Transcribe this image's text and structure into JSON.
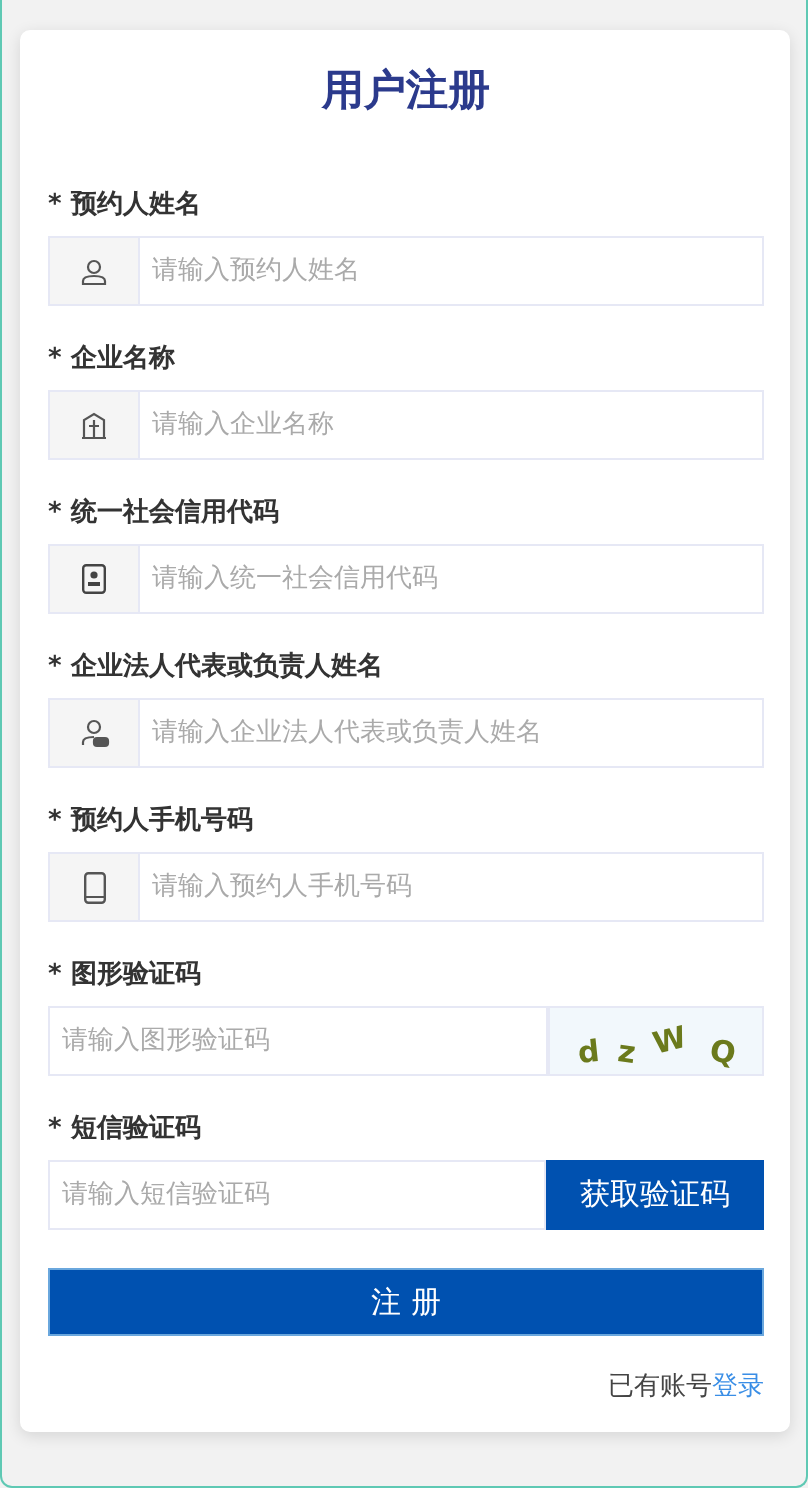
{
  "title": "用户注册",
  "fields": [
    {
      "kind": "icon",
      "required": "*",
      "label": "预约人姓名",
      "placeholder": "请输入预约人姓名"
    },
    {
      "kind": "icon",
      "required": "*",
      "label": "企业名称",
      "placeholder": "请输入企业名称"
    },
    {
      "kind": "icon",
      "required": "*",
      "label": "统一社会信用代码",
      "placeholder": "请输入统一社会信用代码"
    },
    {
      "kind": "icon",
      "required": "*",
      "label": "企业法人代表或负责人姓名",
      "placeholder": "请输入企业法人代表或负责人姓名"
    },
    {
      "kind": "icon",
      "required": "*",
      "label": "预约人手机号码",
      "placeholder": "请输入预约人手机号码"
    },
    {
      "kind": "captcha",
      "required": "*",
      "label": "图形验证码",
      "placeholder": "请输入图形验证码",
      "captcha": [
        "d",
        "z",
        "W",
        "Q"
      ]
    },
    {
      "kind": "sms",
      "required": "*",
      "label": "短信验证码",
      "placeholder": "请输入短信验证码",
      "button": "获取验证码"
    }
  ],
  "submit": "注 册",
  "login_prompt": {
    "text": "已有账号",
    "link": "登录"
  }
}
